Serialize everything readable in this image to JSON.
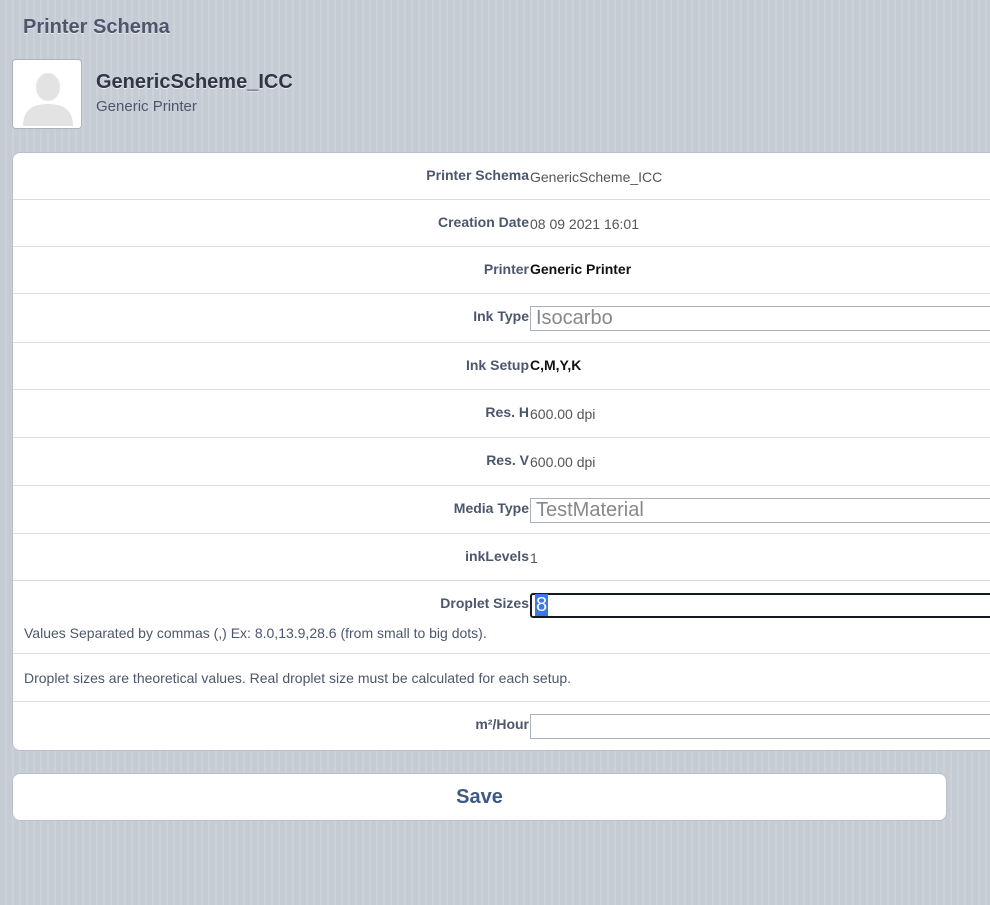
{
  "page": {
    "title": "Printer Schema"
  },
  "header": {
    "name": "GenericScheme_ICC",
    "subtitle": "Generic Printer",
    "avatar_icon": "person-silhouette-icon"
  },
  "form": {
    "printer_schema": {
      "label": "Printer Schema",
      "value": "GenericScheme_ICC"
    },
    "creation_date": {
      "label": "Creation Date",
      "value": "08 09 2021 16:01"
    },
    "printer": {
      "label": "Printer",
      "value": "Generic Printer"
    },
    "ink_type": {
      "label": "Ink Type",
      "value": "Isocarbo"
    },
    "ink_setup": {
      "label": "Ink Setup",
      "value": "C,M,Y,K"
    },
    "res_h": {
      "label": "Res. H",
      "value": "600.00 dpi"
    },
    "res_v": {
      "label": "Res. V",
      "value": "600.00 dpi"
    },
    "media_type": {
      "label": "Media Type",
      "value": "TestMaterial"
    },
    "ink_levels": {
      "label": "inkLevels",
      "value": "1"
    },
    "droplet_sizes": {
      "label": "Droplet Sizes",
      "value": "8",
      "hint": "Values Separated by commas (,) Ex: 8.0,13.9,28.6 (from small to big dots)."
    },
    "droplet_note": "Droplet sizes are theoretical values. Real droplet size must be calculated for each setup.",
    "m2_hour": {
      "label": "m²/Hour",
      "value": ""
    }
  },
  "actions": {
    "save_label": "Save"
  },
  "colors": {
    "accent": "#3c5a86",
    "label": "#4c566c",
    "background": "#c5ccd4"
  }
}
